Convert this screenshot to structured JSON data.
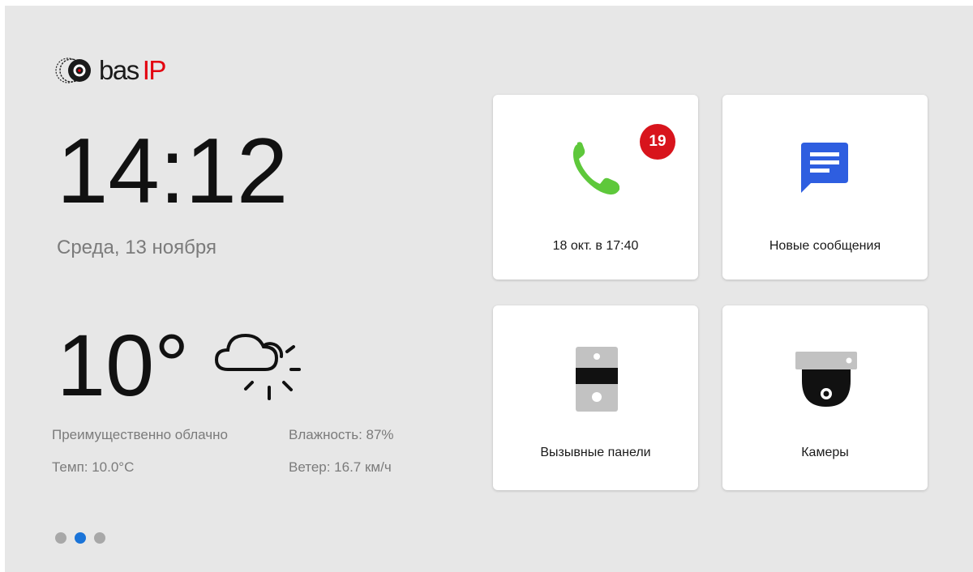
{
  "brand": {
    "name": "bas",
    "suffix": "IP"
  },
  "clock": {
    "time": "14:12",
    "date": "Среда, 13 ноября"
  },
  "weather": {
    "temperature": "10°",
    "condition": "Преимущественно облачно",
    "humidity": "Влажность: 87%",
    "temp_detail": "Темп: 10.0°C",
    "wind": "Ветер: 16.7 км/ч",
    "icon": "cloud-sun-icon"
  },
  "pager": {
    "total": 3,
    "active_index": 1
  },
  "tiles": {
    "calls": {
      "label": "18 окт. в 17:40",
      "badge": "19",
      "icon": "phone-icon",
      "icon_color": "#5ec83b",
      "badge_color": "#d8141c"
    },
    "messages": {
      "label": "Новые сообщения",
      "icon": "message-icon",
      "icon_color": "#2e5ee0"
    },
    "panels": {
      "label": "Вызывные панели",
      "icon": "call-panel-icon"
    },
    "cameras": {
      "label": "Камеры",
      "icon": "dome-camera-icon"
    }
  },
  "colors": {
    "background": "#e7e7e7",
    "accent": "#1b74d8",
    "brand_red": "#e3000f"
  }
}
